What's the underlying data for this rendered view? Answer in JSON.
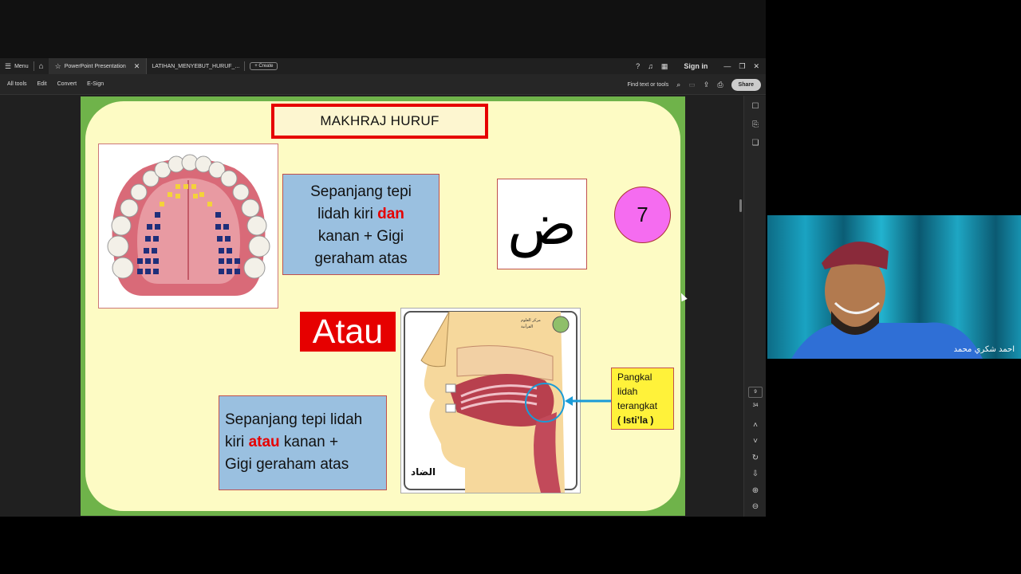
{
  "tabbar": {
    "menu_label": "Menu",
    "tab_active": "PowerPoint Presentation",
    "tab_second": "LATIHAN_MENYEBUT_HURUF_...",
    "create_label": "+ Create",
    "signin_label": "Sign in"
  },
  "toolbar": {
    "tools": [
      "All tools",
      "Edit",
      "Convert",
      "E-Sign"
    ],
    "find_label": "Find text or tools",
    "share_label": "Share"
  },
  "page_nav": {
    "current": "9",
    "total": "34"
  },
  "slide": {
    "title": "MAKHRAJ HURUF",
    "box1": {
      "line1": "Sepanjang tepi",
      "line2a": "lidah kiri ",
      "line2b": "dan",
      "line3": "kanan + Gigi",
      "line4": "geraham atas"
    },
    "letter": "ض",
    "number": "7",
    "atau": "Atau",
    "box2": {
      "line1": "Sepanjang tepi lidah",
      "line2a": "kiri ",
      "line2b": "atau",
      "line2c": " kanan +",
      "line3": "Gigi geraham atas"
    },
    "label": {
      "line1": "Pangkal",
      "line2": "lidah",
      "line3": "terangkat",
      "line4": "( Isti’la )"
    },
    "head_caption": "الضاد"
  },
  "webcam": {
    "name": "احمد شكري محمد"
  },
  "colors": {
    "slide_green": "#6fb34a",
    "slide_bg": "#fdfbc4",
    "accent_red": "#e60000",
    "box_blue": "#9ac0e0",
    "circle_pink": "#f56cf0",
    "label_yellow": "#fff23a"
  }
}
